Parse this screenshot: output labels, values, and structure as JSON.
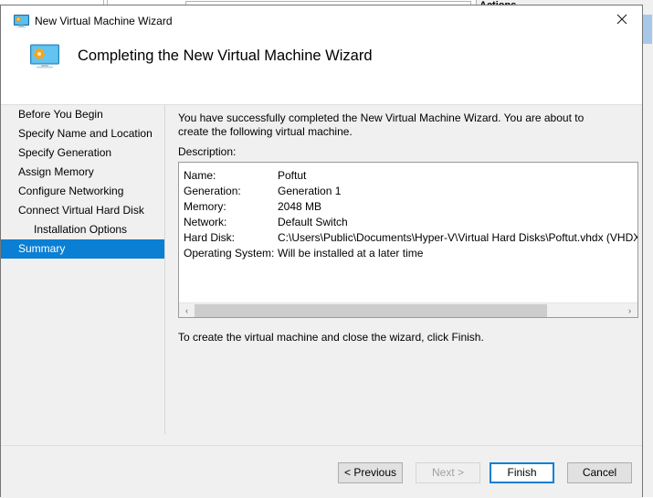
{
  "background": {
    "actions_pane_label": "Actions"
  },
  "dialog": {
    "titlebar": {
      "icon": "virtual-machine-icon",
      "title": "New Virtual Machine Wizard",
      "close_label": "Close"
    },
    "header": {
      "icon": "virtual-machine-icon",
      "title": "Completing the New Virtual Machine Wizard"
    },
    "sidebar": {
      "items": [
        {
          "label": "Before You Begin",
          "selected": false,
          "sub": false
        },
        {
          "label": "Specify Name and Location",
          "selected": false,
          "sub": false
        },
        {
          "label": "Specify Generation",
          "selected": false,
          "sub": false
        },
        {
          "label": "Assign Memory",
          "selected": false,
          "sub": false
        },
        {
          "label": "Configure Networking",
          "selected": false,
          "sub": false
        },
        {
          "label": "Connect Virtual Hard Disk",
          "selected": false,
          "sub": false
        },
        {
          "label": "Installation Options",
          "selected": false,
          "sub": true
        },
        {
          "label": "Summary",
          "selected": true,
          "sub": false
        }
      ],
      "selected_color": "#0a7fd4"
    },
    "content": {
      "intro_text": "You have successfully completed the New Virtual Machine Wizard. You are about to create the following virtual machine.",
      "description_label": "Description:",
      "summary_rows": [
        {
          "key": "Name:",
          "value": "Poftut"
        },
        {
          "key": "Generation:",
          "value": "Generation 1"
        },
        {
          "key": "Memory:",
          "value": "2048 MB"
        },
        {
          "key": "Network:",
          "value": "Default Switch"
        },
        {
          "key": "Hard Disk:",
          "value": "C:\\Users\\Public\\Documents\\Hyper-V\\Virtual Hard Disks\\Poftut.vhdx (VHDX, dynamically expanding)"
        },
        {
          "key": "Operating System:",
          "value": "Will be installed at a later time"
        }
      ],
      "scrollbar": {
        "left_arrow": "‹",
        "right_arrow": "›"
      },
      "finish_note": "To create the virtual machine and close the wizard, click Finish."
    },
    "footer": {
      "previous_label": "< Previous",
      "next_label": "Next >",
      "finish_label": "Finish",
      "cancel_label": "Cancel",
      "next_disabled": true,
      "default_button": "Finish"
    }
  }
}
